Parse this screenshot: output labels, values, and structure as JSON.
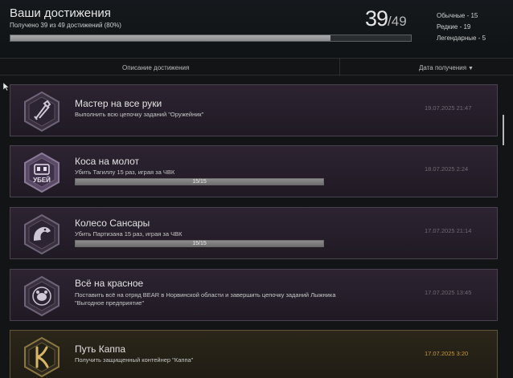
{
  "header": {
    "title": "Ваши достижения",
    "subtitle": "Получено 39 из 49 достижений (80%)",
    "progress": 0.8,
    "count": "39",
    "total": "/49",
    "rarity": [
      "Обычные - 15",
      "Редкие - 19",
      "Легендарные - 5"
    ]
  },
  "columns": {
    "description": "Описание достижения",
    "date": "Дата получения"
  },
  "achievements": [
    {
      "title": "Мастер на все руки",
      "desc": "Выполнить всю цепочку заданий \"Оружейник\"",
      "date": "19.07.2025 21:47",
      "rarity": "rare",
      "icon": "wrench-icon"
    },
    {
      "title": "Коса на молот",
      "desc": "Убить Тагиллу 15 раз, играя за ЧВК",
      "date": "18.07.2025 2:24",
      "rarity": "rare",
      "icon": "tagilla-mask-icon",
      "progress_text": "15/15",
      "progress": 1.0
    },
    {
      "title": "Колесо Сансары",
      "desc": "Убить Партизана 15 раз, играя за ЧВК",
      "date": "17.07.2025 21:14",
      "rarity": "rare",
      "icon": "bird-icon",
      "progress_text": "15/15",
      "progress": 1.0
    },
    {
      "title": "Всё на красное",
      "desc": "Поставить всё на отряд BEAR в Норвинской области и завершить цепочку заданий Лыжника \"Выгодное предприятие\"",
      "date": "17.07.2025 13:45",
      "rarity": "rare",
      "icon": "bear-emblem-icon"
    },
    {
      "title": "Путь Каппа",
      "desc": "Получить защищенный контейнер \"Каппа\"",
      "date": "17.07.2025 3:20",
      "rarity": "legendary",
      "icon": "kappa-icon"
    }
  ],
  "colors": {
    "rare_frame": "#4a4250",
    "legendary_frame": "#5f5538",
    "legendary_date": "#c79a3c"
  }
}
